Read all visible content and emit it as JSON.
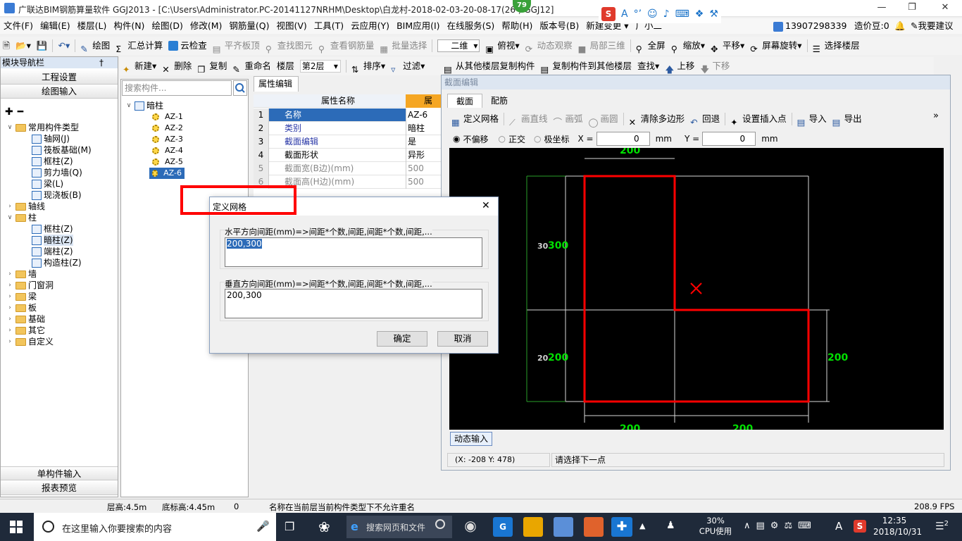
{
  "titlebar": {
    "title": "广联达BIM钢筋算量软件 GGJ2013 - [C:\\Users\\Administrator.PC-20141127NRHM\\Desktop\\白龙村-2018-02-03-20-08-17(26  ) GGJ12]",
    "badge": "79",
    "ime_letter": "S",
    "ime_items": [
      "A",
      "°’",
      "☺",
      "♪",
      "⌨",
      "❖",
      "⚒"
    ]
  },
  "menubar": {
    "items": [
      "文件(F)",
      "编辑(E)",
      "楼层(L)",
      "构件(N)",
      "绘图(D)",
      "修改(M)",
      "钢筋量(Q)",
      "视图(V)",
      "工具(T)",
      "云应用(Y)",
      "BIM应用(I)",
      "在线服务(S)",
      "帮助(H)",
      "版本号(B)",
      "新建变更 ▾",
      "广小二"
    ],
    "phone": "13907298339",
    "coins": "造价豆:0",
    "suggest": "我要建议"
  },
  "toolbar1": {
    "items": [
      "绘图",
      "汇总计算",
      "云检查",
      "平齐板顶",
      "查找图元",
      "查看钢筋量",
      "批量选择"
    ],
    "view_select": "二维",
    "items2": [
      "俯视",
      "动态观察",
      "局部三维",
      "全屏",
      "缩放",
      "平移",
      "屏幕旋转",
      "选择楼层"
    ]
  },
  "toolbar2": {
    "items": [
      "新建",
      "删除",
      "复制",
      "重命名"
    ],
    "floor_label": "楼层",
    "floor_value": "第2层",
    "items2": [
      "排序",
      "过滤",
      "从其他楼层复制构件",
      "复制构件到其他楼层",
      "查找",
      "上移",
      "下移"
    ]
  },
  "nav": {
    "header": "模块导航栏",
    "pin": "†",
    "project_settings": "工程设置",
    "drawing_input": "绘图输入",
    "tree": {
      "common": "常用构件类型",
      "common_items": [
        "轴网(J)",
        "筏板基础(M)",
        "框柱(Z)",
        "剪力墙(Q)",
        "梁(L)",
        "现浇板(B)"
      ],
      "axis": "轴线",
      "column": "柱",
      "column_items": [
        "框柱(Z)",
        "暗柱(Z)",
        "端柱(Z)",
        "构造柱(Z)"
      ],
      "others": [
        "墙",
        "门窗洞",
        "梁",
        "板",
        "基础",
        "其它",
        "自定义"
      ]
    },
    "single_input": "单构件输入",
    "report": "报表预览"
  },
  "component_list": {
    "search_placeholder": "搜索构件...",
    "root": "暗柱",
    "items": [
      "AZ-1",
      "AZ-2",
      "AZ-3",
      "AZ-4",
      "AZ-5",
      "AZ-6"
    ]
  },
  "properties": {
    "tab": "属性编辑",
    "header": "属性名称",
    "header_right": "属",
    "rows": [
      {
        "n": "1",
        "k": "名称",
        "v": "AZ-6"
      },
      {
        "n": "2",
        "k": "类别",
        "v": "暗柱"
      },
      {
        "n": "3",
        "k": "截面编辑",
        "v": "是"
      },
      {
        "n": "4",
        "k": "截面形状",
        "v": "异形"
      },
      {
        "n": "5",
        "k": "截面宽(B边)(mm)",
        "v": "500"
      },
      {
        "n": "6",
        "k": "截面高(H边)(mm)",
        "v": "500"
      }
    ]
  },
  "section_editor": {
    "title": "截面编辑",
    "tabs": [
      "截面",
      "配筋"
    ],
    "tools": [
      "定义网格",
      "画直线",
      "画弧",
      "画圆",
      "清除多边形",
      "回退",
      "设置插入点",
      "导入",
      "导出"
    ],
    "more": "»",
    "offset_options": [
      "不偏移",
      "正交",
      "极坐标"
    ],
    "x_label": "X =",
    "x_value": "0",
    "y_label": "Y =",
    "y_value": "0",
    "unit": "mm",
    "dims": {
      "top": "200",
      "left_top_a": "30",
      "left_top_b": "300",
      "left_bottom_a": "20",
      "left_bottom_b": "200",
      "right": "200",
      "bottom_left": "200",
      "bottom_right": "200"
    },
    "dynamic_input": "动态输入",
    "coords": "(X: -208 Y: 478)",
    "prompt": "请选择下一点",
    "colors": {
      "canvas": "#000000",
      "shape": "#ff0000",
      "dim": "#00e000",
      "grid": "#ffffff"
    }
  },
  "dialog": {
    "title": "定义网格",
    "h_label": "水平方向间距(mm)=>间距*个数,间距,间距*个数,间距,...",
    "h_value": "200,300",
    "v_label": "垂直方向间距(mm)=>间距*个数,间距,间距*个数,间距,...",
    "v_value": "200,300",
    "ok": "确定",
    "cancel": "取消",
    "close": "✕",
    "highlight_color": "#ff0000"
  },
  "statusbar": {
    "floor_height": "层高:4.5m",
    "base_height": "底标高:4.45m",
    "zero": "0",
    "message": "名称在当前层当前构件类型下不允许重名",
    "fps": "208.9 FPS"
  },
  "taskbar": {
    "search": "在这里输入你要搜索的内容",
    "browser_search": "搜索网页和文件",
    "cpu_percent": "30%",
    "cpu_label": "CPU使用",
    "ime": "A",
    "time": "12:35",
    "date": "2018/10/31",
    "notif": "2"
  }
}
